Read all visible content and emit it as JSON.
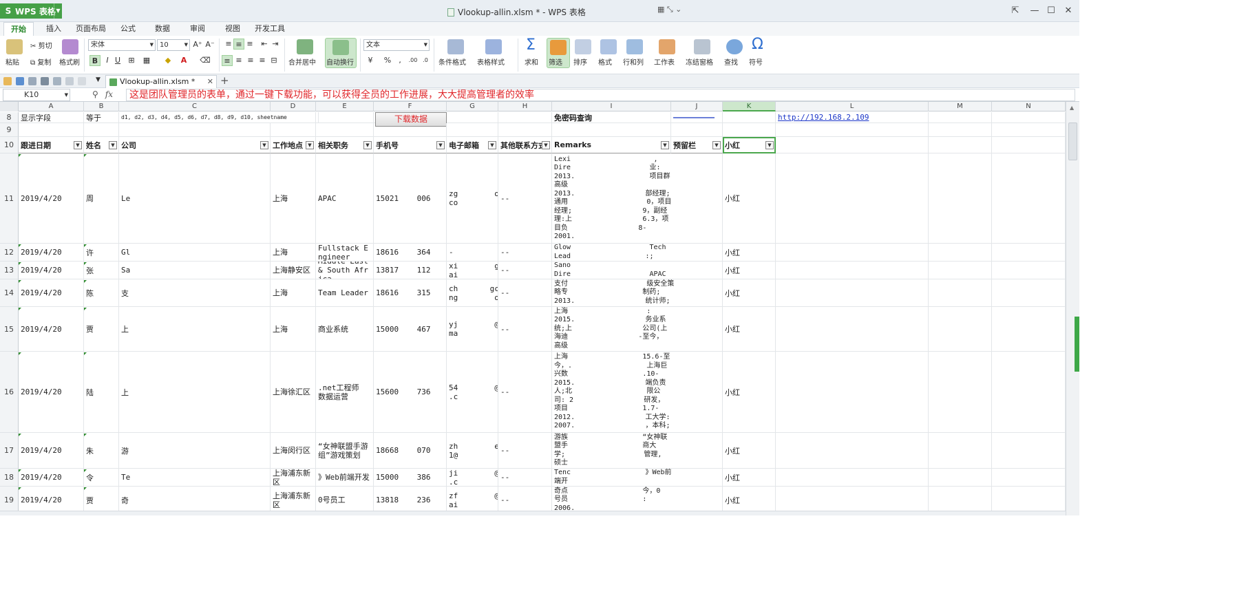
{
  "titlebar": {
    "app_name": "WPS 表格",
    "window_title": "Vlookup-allin.xlsm * - WPS 表格"
  },
  "menu": [
    "开始",
    "插入",
    "页面布局",
    "公式",
    "数据",
    "审阅",
    "视图",
    "开发工具"
  ],
  "ribbon": {
    "paste": "粘贴",
    "cut": "剪切",
    "copy": "复制",
    "format_painter": "格式刷",
    "font_name": "宋体",
    "font_size": "10",
    "merge_center": "合并居中",
    "wrap_text": "自动换行",
    "number_format": "文本",
    "cond_format": "条件格式",
    "table_style": "表格样式",
    "sum": "求和",
    "filter": "筛选",
    "sort": "排序",
    "format": "格式",
    "rows_cols": "行和列",
    "worksheet": "工作表",
    "freeze": "冻结窗格",
    "find": "查找",
    "symbol": "符号"
  },
  "doc_tab": "Vlookup-allin.xlsm *",
  "formula_bar": {
    "name_box": "K10",
    "fx": "fx",
    "content": "这是团队管理员的表单，通过一键下载功能，可以获得全员的工作进展，大大提高管理者的效率"
  },
  "columns": [
    "A",
    "B",
    "C",
    "D",
    "E",
    "F",
    "G",
    "H",
    "I",
    "J",
    "K",
    "L",
    "M",
    "N"
  ],
  "row8": {
    "label": "显示字段",
    "eq": "等于",
    "fields": "d1, d2, d3, d4, d5, d6, d7, d8, d9, d10, sheetname",
    "button": "下载数据",
    "nopass": "免密码查询",
    "link": "http://192.168.2.109"
  },
  "headers": [
    "跟进日期",
    "姓名",
    "公司",
    "工作地点",
    "相关职务",
    "手机号",
    "电子邮箱",
    "其他联系方式",
    "Remarks",
    "预留栏",
    "小红"
  ],
  "rows": [
    {
      "n": "11",
      "date": "2019/4/20",
      "name": "周",
      "company": "Le",
      "loc": "上海",
      "title": "APAC",
      "phone": "15021    006",
      "email": "zg        oo.\nco",
      "other": "--",
      "remarks": "Lexi                    ,\nDire                   业:\n2013.                  项目群\n高级                    \n2013.                 部经理;\n通用                   0，项目\n经理;                 9，副经\n理:上                 6.3，项\n目负                 8-\n2001.",
      "k": "小红"
    },
    {
      "n": "12",
      "date": "2019/4/20",
      "name": "许",
      "company": "Gl",
      "loc": "上海",
      "title": "Fullstack Engineer",
      "phone": "18616    364",
      "email": "-",
      "other": "--",
      "remarks": "Glow                   Tech\nLead                  :;",
      "k": "小红"
    },
    {
      "n": "13",
      "date": "2019/4/20",
      "name": "张",
      "company": "Sa",
      "loc": "上海静安区",
      "title": "Middle East & South Africa",
      "phone": "13817    112",
      "email": "xi        g@gm\nai",
      "other": "--",
      "remarks": "Sano\nDire                   APAC",
      "k": "小红"
    },
    {
      "n": "14",
      "date": "2019/4/20",
      "name": "陈",
      "company": "支",
      "loc": "上海",
      "title": "Team Leader",
      "phone": "18616    315",
      "email": "ch       gche\nng        om",
      "other": "--",
      "remarks": "支付                   级安全策\n略专                  制药;\n2013.                 统计师;",
      "k": "小红"
    },
    {
      "n": "15",
      "date": "2019/4/20",
      "name": "贾",
      "company": "上",
      "loc": "上海",
      "title": "商业系统",
      "phone": "15000    467",
      "email": "yj        @hot\nma",
      "other": "--",
      "remarks": "上海                   :\n2015.                 务业系\n统;上                 公司(上\n海迪                 -至今，\n高级",
      "k": "小红"
    },
    {
      "n": "16",
      "date": "2019/4/20",
      "name": "陆",
      "company": "上",
      "loc": "上海徐汇区",
      ".title": "",
      "title": ".net工程师 数据运营",
      "phone": "15600    736",
      "email": "54        @qq\n.c",
      "other": "--",
      "remarks": "上海                  15.6-至\n今，.                  上海巨\n兴数                  .10-\n2015.                 端负责\n人;北                  限公\n司: 2                 研发，\n项目                  1.7-\n2012.                 工大学:\n2007.                 ，本科;",
      "k": "小红"
    },
    {
      "n": "17",
      "date": "2019/4/20",
      "name": "朱",
      "company": "游",
      "loc": "上海闵行区",
      "title": "“女神联盟手游组”游戏策划",
      "phone": "18668    070",
      "email": "zh        e71\n1@",
      "other": "--",
      "remarks": "游族                  “女神联\n盟手                  商大\n学;                   管理,\n硕士",
      "k": "小红"
    },
    {
      "n": "18",
      "date": "2019/4/20",
      "name": "令",
      "company": "Te",
      "loc": "上海浦东新区",
      "title": "》Web前端开发",
      "phone": "15000    386",
      "email": "ji        @msn\n.c",
      "other": "--",
      "remarks": "Tenc                  》Web前\n端开",
      "k": "小红"
    },
    {
      "n": "19",
      "date": "2019/4/20",
      "name": "贾",
      "company": "奇",
      "loc": "上海浦东新区",
      "title": "0号员工",
      "phone": "13818    236",
      "email": "zf        @gm\nai",
      "other": "--",
      "remarks": "奇点                  今，0\n号员                  :\n2006.",
      "k": "小红"
    }
  ]
}
